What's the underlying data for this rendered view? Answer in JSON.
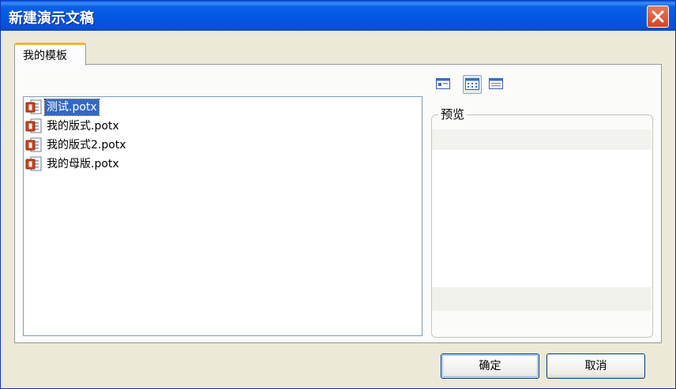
{
  "window": {
    "title": "新建演示文稿"
  },
  "tabs": [
    {
      "label": "我的模板"
    }
  ],
  "files": [
    {
      "name": "测试.potx",
      "selected": true
    },
    {
      "name": "我的版式.potx",
      "selected": false
    },
    {
      "name": "我的版式2.potx",
      "selected": false
    },
    {
      "name": "我的母版.potx",
      "selected": false
    }
  ],
  "view_buttons": [
    {
      "icon": "large-icons-view-icon",
      "active": false
    },
    {
      "icon": "list-view-icon",
      "active": true
    },
    {
      "icon": "details-view-icon",
      "active": false
    }
  ],
  "preview": {
    "label": "预览"
  },
  "buttons": {
    "ok": "确定",
    "cancel": "取消"
  },
  "colors": {
    "title_bar": "#0456e2",
    "selection": "#316ac5",
    "tab_accent": "#f7b42c",
    "close_button": "#d6441f"
  }
}
